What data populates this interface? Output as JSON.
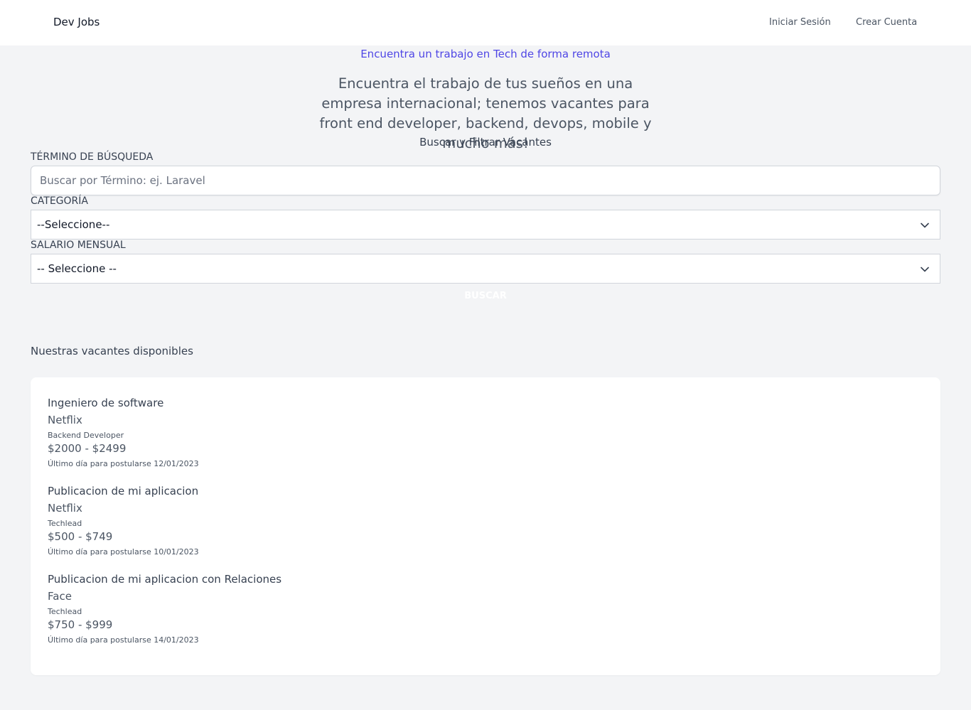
{
  "header": {
    "brand": "Dev Jobs",
    "nav": {
      "login": "Iniciar Sesión",
      "register": "Crear Cuenta"
    }
  },
  "hero": {
    "tagline": "Encuentra un trabajo en Tech de forma remota",
    "title": "Encuentra el trabajo de tus sueños en una empresa internacional; tenemos vacantes para front end developer, backend, devops, mobile y mucho más!"
  },
  "filters": {
    "heading": "Buscar y Filtrar Vacantes",
    "term": {
      "label": "Término de Búsqueda",
      "placeholder": "Buscar por Término: ej. Laravel",
      "value": ""
    },
    "category": {
      "label": "Categoría",
      "selected": "--Seleccione--"
    },
    "salary": {
      "label": "Salario Mensual",
      "selected": "-- Seleccione --"
    },
    "submit": "Buscar"
  },
  "listing": {
    "title": "Nuestras vacantes disponibles",
    "jobs": [
      {
        "title": "Ingeniero de software",
        "company": "Netflix",
        "category": "Backend Developer",
        "salary": "$2000 - $2499",
        "deadline": "Último día para postularse 12/01/2023"
      },
      {
        "title": "Publicacion de mi aplicacion",
        "company": "Netflix",
        "category": "Techlead",
        "salary": "$500 - $749",
        "deadline": "Último día para postularse 10/01/2023"
      },
      {
        "title": "Publicacion de mi aplicacion con Relaciones",
        "company": "Face",
        "category": "Techlead",
        "salary": "$750 - $999",
        "deadline": "Último día para postularse 14/01/2023"
      }
    ]
  },
  "colors": {
    "accent": "#4f46e5",
    "background": "#f3f4f6",
    "card": "#ffffff"
  },
  "icons": {
    "select_arrow": "chevron-down-icon"
  }
}
